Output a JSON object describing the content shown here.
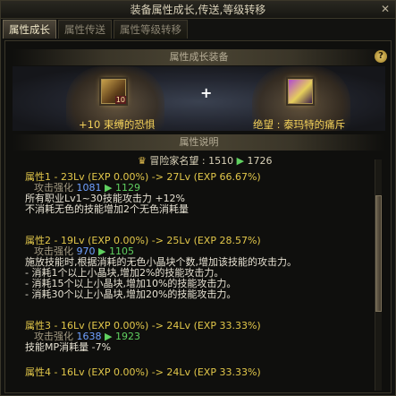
{
  "window": {
    "title": "装备属性成长,传送,等级转移",
    "close_label": "✕"
  },
  "tabs": [
    {
      "label": "属性成长",
      "active": true
    },
    {
      "label": "属性传送",
      "active": false
    },
    {
      "label": "属性等级转移",
      "active": false
    }
  ],
  "growth": {
    "header": "属性成长装备",
    "help_label": "?"
  },
  "equip": {
    "left": {
      "name": "+10 束缚的恐惧",
      "slot_badge": "10"
    },
    "right": {
      "name": "绝望 : 泰玛特的痛斥"
    },
    "plus": "+"
  },
  "desc": {
    "header": "属性说明",
    "fame": {
      "icon": "adventurer-crown-icon",
      "label": "冒险家名望 :",
      "from": "1510",
      "arrow": "▶",
      "to": "1726"
    },
    "attrs": [
      {
        "head_from": "属性1 - 23Lv (EXP 0.00%)",
        "head_to": "-> 27Lv (EXP 66.67%)",
        "sub_label": "攻击强化",
        "sub_from": "1081",
        "sub_arrow": "▶",
        "sub_to": "1129",
        "effects": [
          "所有职业Lv1~30技能攻击力 +12%",
          "不消耗无色的技能增加2个无色消耗量"
        ]
      },
      {
        "head_from": "属性2 - 19Lv (EXP 0.00%)",
        "head_to": "-> 25Lv (EXP 28.57%)",
        "sub_label": "攻击强化",
        "sub_from": "970",
        "sub_arrow": "▶",
        "sub_to": "1105",
        "effects": [
          "施放技能时,根据消耗的无色小晶块个数,增加该技能的攻击力。",
          "- 消耗1个以上小晶块,增加2%的技能攻击力。",
          "- 消耗15个以上小晶块,增加10%的技能攻击力。",
          "- 消耗30个以上小晶块,增加20%的技能攻击力。"
        ]
      },
      {
        "head_from": "属性3 - 16Lv (EXP 0.00%)",
        "head_to": "-> 24Lv (EXP 33.33%)",
        "sub_label": "攻击强化",
        "sub_from": "1638",
        "sub_arrow": "▶",
        "sub_to": "1923",
        "effects": [
          "技能MP消耗量 -7%"
        ]
      },
      {
        "head_from": "属性4 - 16Lv (EXP 0.00%)",
        "head_to": "-> 24Lv (EXP 33.33%)"
      }
    ]
  },
  "colors": {
    "gold": "#e2c74a",
    "green": "#60d060",
    "blue": "#6fa0ff",
    "frame": "#3a3629"
  }
}
